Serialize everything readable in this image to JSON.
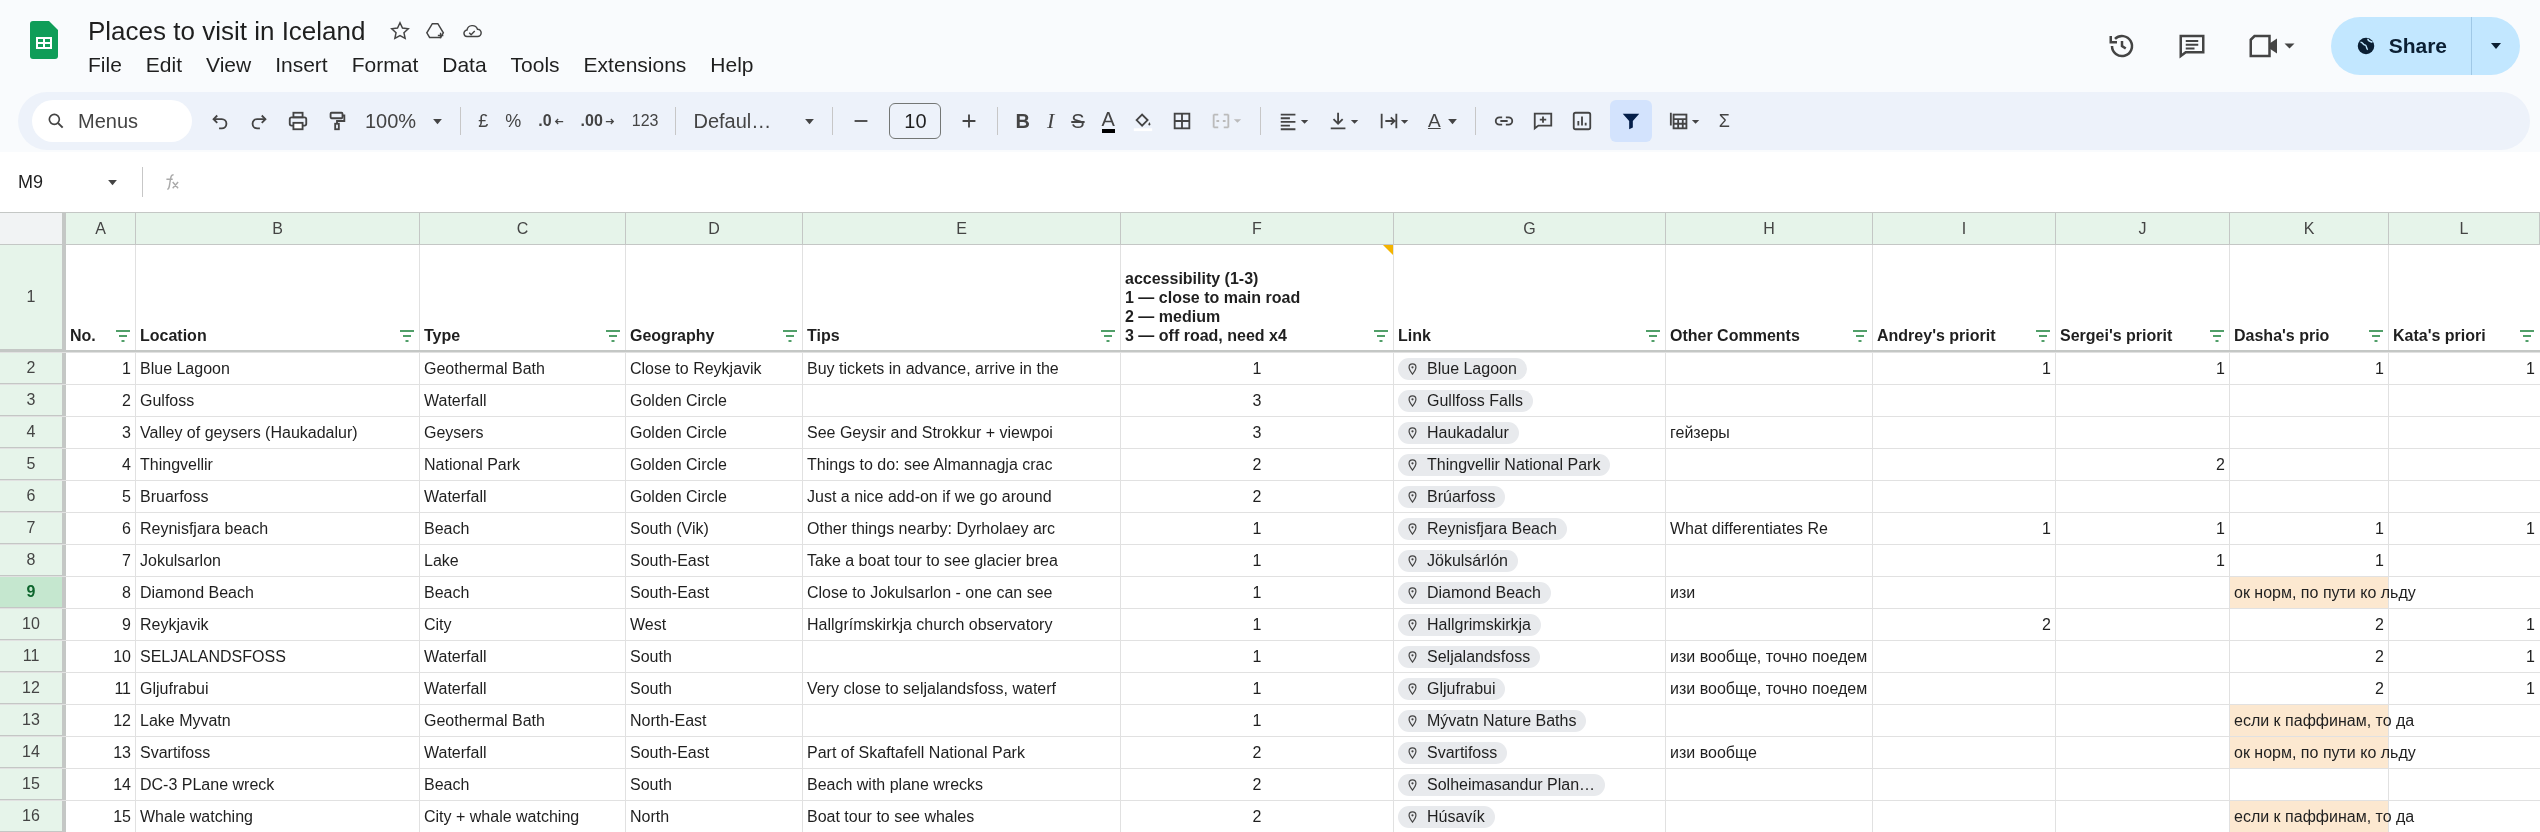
{
  "document": {
    "title": "Places to visit in Iceland",
    "starred": false
  },
  "menu": [
    "File",
    "Edit",
    "View",
    "Insert",
    "Format",
    "Data",
    "Tools",
    "Extensions",
    "Help"
  ],
  "share_button": "Share",
  "toolbar": {
    "search_placeholder": "Menus",
    "zoom": "100%",
    "currency": "£",
    "percent": "%",
    "decrease_decimals": ".0",
    "increase_decimals": ".00",
    "number_format": "123",
    "font": "Defaul…",
    "font_size": "10",
    "bold": "B",
    "italic": "I",
    "strikethrough": "S",
    "text_color": "A",
    "text_rotation": "A",
    "functions": "Σ",
    "merge_disabled": true,
    "filter_on": true
  },
  "name_box": "M9",
  "columns": [
    {
      "letter": "A",
      "header": "No.",
      "kind": "number"
    },
    {
      "letter": "B",
      "header": "Location",
      "kind": "text"
    },
    {
      "letter": "C",
      "header": "Type",
      "kind": "text"
    },
    {
      "letter": "D",
      "header": "Geography",
      "kind": "text"
    },
    {
      "letter": "E",
      "header": "Tips",
      "kind": "text"
    },
    {
      "letter": "F",
      "header": "accessibility (1-3)\n1 — close to main road\n2 — medium\n3 — off road, need x4",
      "kind": "center",
      "has_note": true
    },
    {
      "letter": "G",
      "header": "Link",
      "kind": "link"
    },
    {
      "letter": "H",
      "header": "Other Comments",
      "kind": "text"
    },
    {
      "letter": "I",
      "header": "Andrey's priorit",
      "kind": "number"
    },
    {
      "letter": "J",
      "header": "Sergei's priorit",
      "kind": "number"
    },
    {
      "letter": "K",
      "header": "Dasha's prio",
      "kind": "number"
    },
    {
      "letter": "L",
      "header": "Kata's priori",
      "kind": "number"
    }
  ],
  "header_row_number": "1",
  "rows": [
    {
      "number": "2",
      "selected": false,
      "cells": [
        "1",
        "Blue Lagoon",
        "Geothermal Bath",
        "Close to Reykjavik",
        "Buy tickets in advance, arrive in the",
        "1",
        "Blue Lagoon",
        null,
        "1",
        "1",
        "1",
        "1"
      ]
    },
    {
      "number": "3",
      "selected": false,
      "cells": [
        "2",
        "Gulfoss",
        "Waterfall",
        "Golden Circle",
        null,
        "3",
        "Gullfoss Falls",
        null,
        null,
        null,
        null,
        null
      ]
    },
    {
      "number": "4",
      "selected": false,
      "cells": [
        "3",
        "Valley of geysers (Haukadalur)",
        "Geysers",
        "Golden Circle",
        "See Geysir and Strokkur + viewpoi",
        "3",
        "Haukadalur",
        "гейзеры",
        null,
        null,
        null,
        null
      ]
    },
    {
      "number": "5",
      "selected": false,
      "cells": [
        "4",
        "Thingvellir",
        "National Park",
        "Golden Circle",
        "Things to do: see Almannagja crac",
        "2",
        "Thingvellir National Park",
        null,
        null,
        "2",
        null,
        null
      ]
    },
    {
      "number": "6",
      "selected": false,
      "cells": [
        "5",
        "Bruarfoss",
        "Waterfall",
        "Golden Circle",
        "Just a nice add-on if we go around",
        "2",
        "Brúarfoss",
        null,
        null,
        null,
        null,
        null
      ]
    },
    {
      "number": "7",
      "selected": false,
      "cells": [
        "6",
        "Reynisfjara beach",
        "Beach",
        "South (Vik)",
        "Other things nearby: Dyrholaey arc",
        "1",
        "Reynisfjara Beach",
        "What differentiates Re",
        "1",
        "1",
        "1",
        "1"
      ]
    },
    {
      "number": "8",
      "selected": false,
      "cells": [
        "7",
        "Jokulsarlon",
        "Lake",
        "South-East",
        "Take a boat tour to see glacier brea",
        "1",
        "Jökulsárlón",
        null,
        null,
        "1",
        "1",
        null
      ]
    },
    {
      "number": "9",
      "selected": true,
      "cells": [
        "8",
        "Diamond Beach",
        "Beach",
        "South-East",
        "Close to Jokulsarlon - one can see",
        "1",
        "Diamond Beach",
        "изи",
        null,
        null,
        {
          "text": "ок норм, по пути ко льду",
          "highlighted": true
        },
        null
      ]
    },
    {
      "number": "10",
      "selected": false,
      "cells": [
        "9",
        "Reykjavik",
        "City",
        "West",
        "Hallgrímskirkja church observatory",
        "1",
        "Hallgrimskirkja",
        null,
        "2",
        null,
        "2",
        "1"
      ]
    },
    {
      "number": "11",
      "selected": false,
      "cells": [
        "10",
        "SELJALANDSFOSS",
        "Waterfall",
        "South",
        null,
        "1",
        "Seljalandsfoss",
        "изи вообще, точно поедем",
        null,
        null,
        "2",
        "1"
      ]
    },
    {
      "number": "12",
      "selected": false,
      "cells": [
        "11",
        "Gljufrabui",
        "Waterfall",
        "South",
        "Very close to seljalandsfoss, waterf",
        "1",
        "Gljufrabui",
        "изи вообще, точно поедем",
        null,
        null,
        "2",
        "1"
      ]
    },
    {
      "number": "13",
      "selected": false,
      "cells": [
        "12",
        "Lake Myvatn",
        "Geothermal Bath",
        "North-East",
        null,
        "1",
        "Mývatn Nature Baths",
        null,
        null,
        null,
        {
          "text": "если к паффинам, то да",
          "highlighted": true
        },
        null
      ]
    },
    {
      "number": "14",
      "selected": false,
      "cells": [
        "13",
        "Svartifoss",
        "Waterfall",
        "South-East",
        "Part of Skaftafell National Park",
        "2",
        "Svartifoss",
        "изи вообще",
        null,
        null,
        {
          "text": "ок норм, по пути ко льду",
          "highlighted": true
        },
        null
      ]
    },
    {
      "number": "15",
      "selected": false,
      "cells": [
        "14",
        "DC-3 PLane wreck",
        "Beach",
        "South",
        "Beach with plane wrecks",
        "2",
        "Solheimasandur Plan…",
        null,
        null,
        null,
        null,
        null
      ]
    },
    {
      "number": "16",
      "selected": false,
      "cells": [
        "15",
        "Whale watching",
        "City + whale watching",
        "North",
        "Boat tour to see whales",
        "2",
        "Húsavík",
        null,
        null,
        null,
        {
          "text": "если к паффинам, то да",
          "highlighted": true
        },
        null
      ]
    }
  ]
}
